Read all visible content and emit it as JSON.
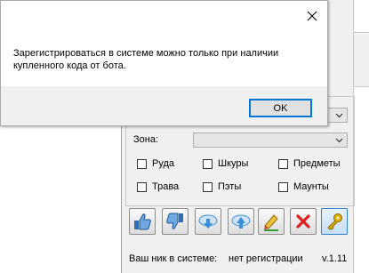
{
  "dialog": {
    "message": "Зарегистрироваться в системе можно только при наличии купленного кода от бота.",
    "ok_label": "OK"
  },
  "zone": {
    "label": "Зона:"
  },
  "checkboxes": {
    "ore": "Руда",
    "skins": "Шкуры",
    "items": "Предметы",
    "grass": "Трава",
    "heels": "Пэты",
    "mounts": "Маунты"
  },
  "toolbar": {
    "icons": [
      "thumbs-up-icon",
      "thumbs-down-icon",
      "cloud-download-icon",
      "cloud-upload-icon",
      "pencil-icon",
      "delete-x-icon",
      "key-icon"
    ]
  },
  "status": {
    "nick_label": "Ваш ник в системе:",
    "nick_value": "нет регистрации",
    "version": "v.1.11"
  },
  "colors": {
    "ok_border": "#0078d7",
    "delete_red": "#e02020",
    "key_gold": "#e0b000",
    "cloud_blue": "#3a8fd8"
  }
}
